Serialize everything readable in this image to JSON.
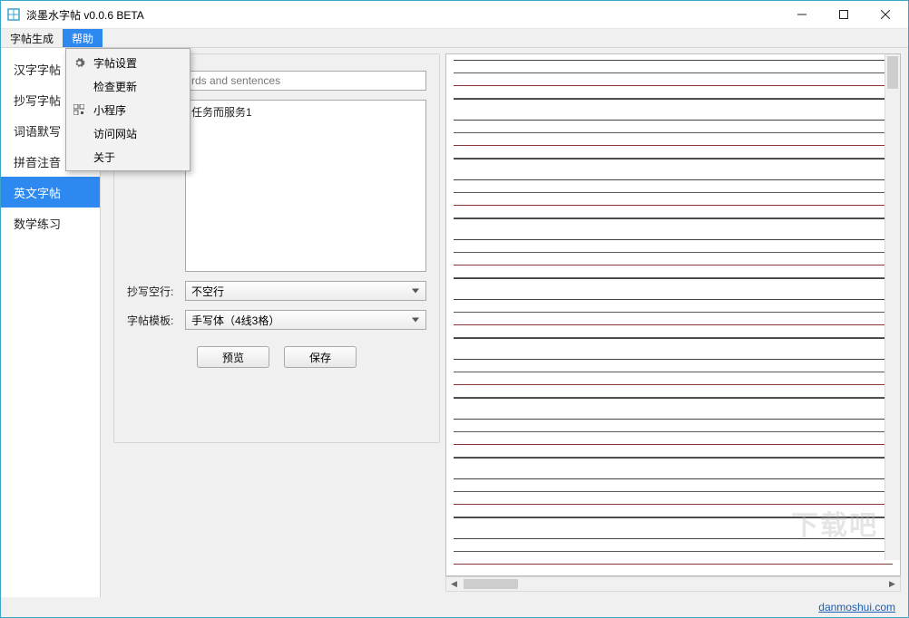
{
  "window": {
    "title": "淡墨水字帖 v0.0.6 BETA"
  },
  "menubar": {
    "items": [
      "字帖生成",
      "帮助"
    ],
    "active_index": 1
  },
  "help_menu": {
    "items": [
      {
        "icon": "gear-icon",
        "label": "字帖设置"
      },
      {
        "icon": "",
        "label": "检查更新"
      },
      {
        "icon": "qr-icon",
        "label": "小程序"
      },
      {
        "icon": "",
        "label": "访问网站"
      },
      {
        "icon": "",
        "label": "关于"
      }
    ]
  },
  "sidebar": {
    "items": [
      "汉字字帖",
      "抄写字帖",
      "词语默写",
      "拼音注音",
      "英文字帖",
      "数学练习"
    ],
    "selected_index": 4
  },
  "form": {
    "title_placeholder": "rds and sentences",
    "content_value": "任务而服务1",
    "row_spacing_label": "抄写空行:",
    "row_spacing_value": "不空行",
    "template_label": "字帖模板:",
    "template_value": "手写体（4线3格）",
    "preview_btn": "预览",
    "save_btn": "保存"
  },
  "footer": {
    "link_text": "danmoshui.com"
  },
  "watermark": "下载吧"
}
